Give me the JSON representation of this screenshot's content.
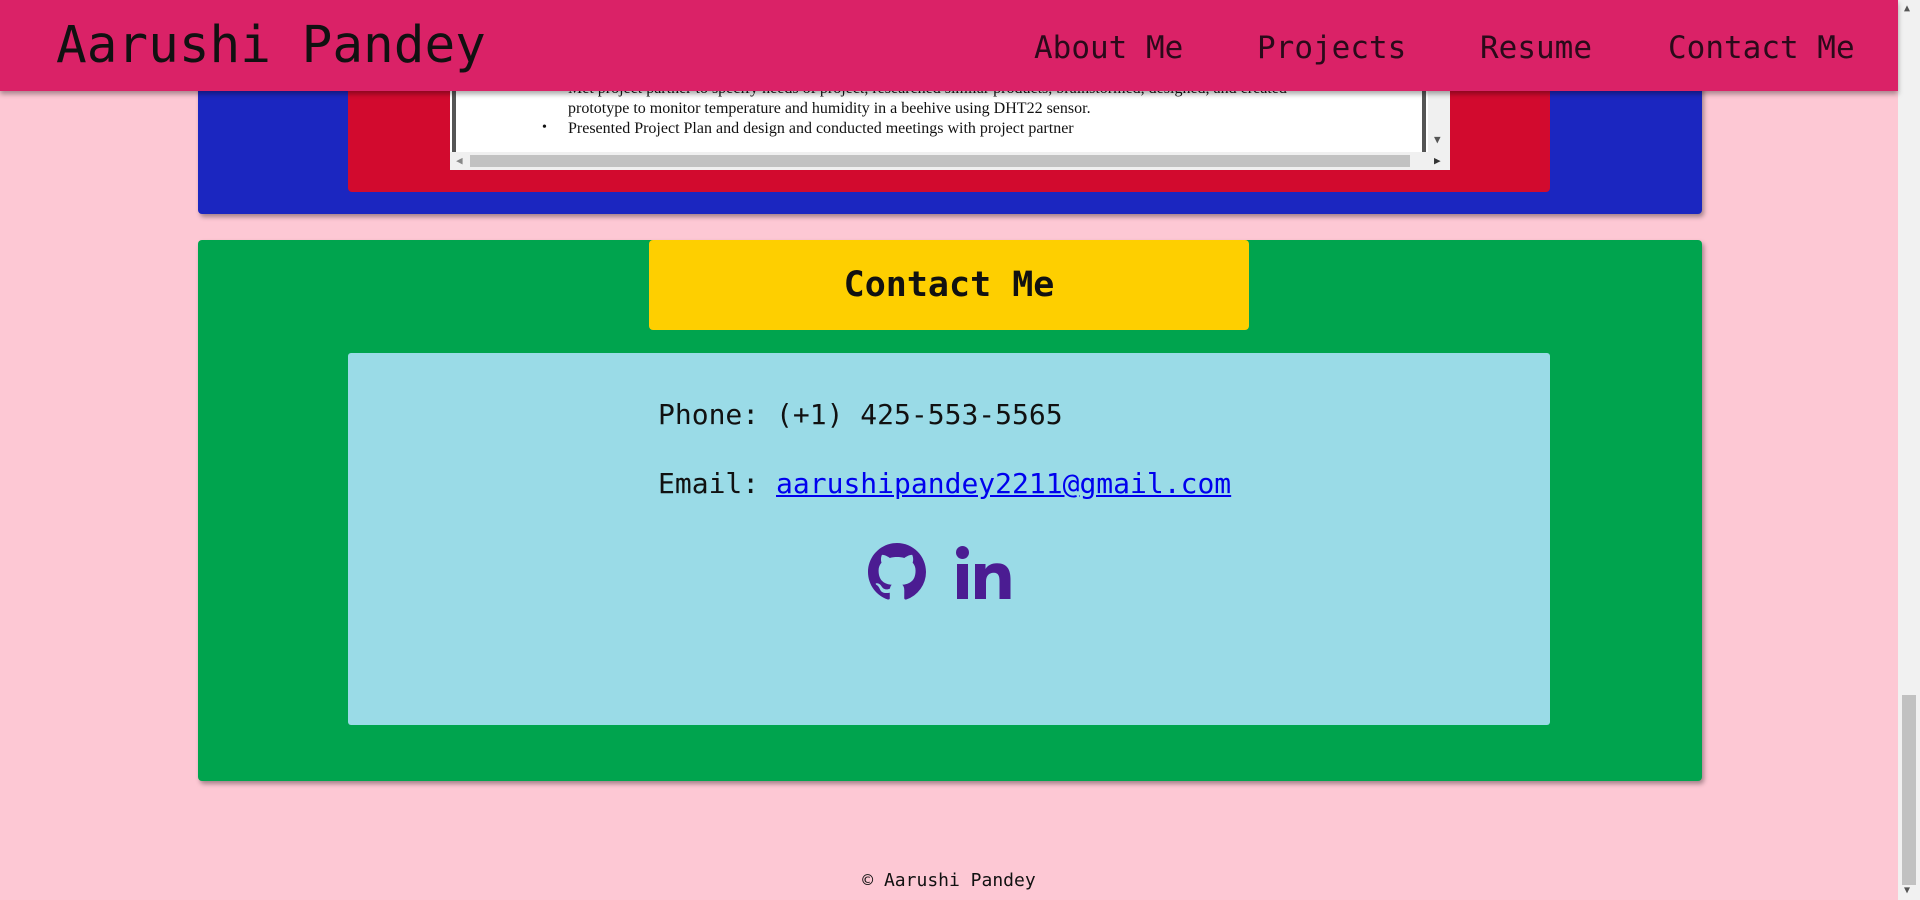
{
  "header": {
    "title": "Aarushi Pandey",
    "nav": {
      "about": "About Me",
      "projects": "Projects",
      "resume": "Resume",
      "contact": "Contact Me"
    }
  },
  "resume": {
    "pdf_lines": [
      "Met project partner to specify needs of project, researched similar products, brainstormed, designed, and created",
      "prototype to monitor temperature and humidity in a beehive using DHT22 sensor.",
      "Presented Project Plan and design and conducted meetings with project partner"
    ],
    "bullet": "•"
  },
  "contact": {
    "heading": "Contact Me",
    "phone_label": "Phone:",
    "phone": "(+1) 425-553-5565",
    "email_label": "Email:",
    "email": "aarushipandey2211@gmail.com",
    "social": [
      "github-icon",
      "linkedin-icon"
    ]
  },
  "footer": {
    "text": "© Aarushi Pandey"
  },
  "colors": {
    "page_bg": "#fdc8d4",
    "header_bg": "#da2267",
    "resume_section_bg": "#1b26c0",
    "resume_frame_bg": "#d20a2e",
    "contact_section_bg": "#00a44e",
    "contact_heading_bg": "#fecf00",
    "contact_card_bg": "#9adbe7",
    "icon_color": "#4b1c92",
    "link_color": "#0000ee"
  }
}
